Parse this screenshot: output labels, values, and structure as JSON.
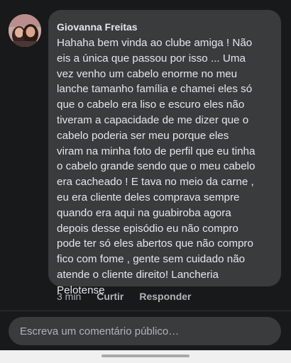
{
  "comment": {
    "author": "Giovanna Freitas",
    "text": "Hahaha bem vinda ao clube amiga ! Não\neis a única que passou por isso ... Uma\nvez venho um cabelo enorme no meu\nlanche  tamanho família e chamei eles só\nque o cabelo era liso e escuro eles não\ntiveram a capacidade de me dizer que o\ncabelo poderia ser meu porque eles\nviram na minha foto de perfil que eu tinha\no cabelo grande sendo que o meu cabelo\nera cacheado ! E tava no meio da carne ,\neu era cliente deles comprava sempre\nquando era aqui na guabiroba agora\ndepois desse episódio eu não compro\npode ter só eles abertos que não compro\nfico com fome , gente sem cuidado não\natende o cliente direito! Lancheria\nPelotense"
  },
  "actions": {
    "time": "3 min",
    "like_label": "Curtir",
    "reply_label": "Responder"
  },
  "composer": {
    "placeholder": "Escreva um comentário público…"
  },
  "colors": {
    "background": "#18191a",
    "bubble": "#3a3b3c",
    "text": "#e4e6eb",
    "secondary_text": "#b0b3b8"
  }
}
